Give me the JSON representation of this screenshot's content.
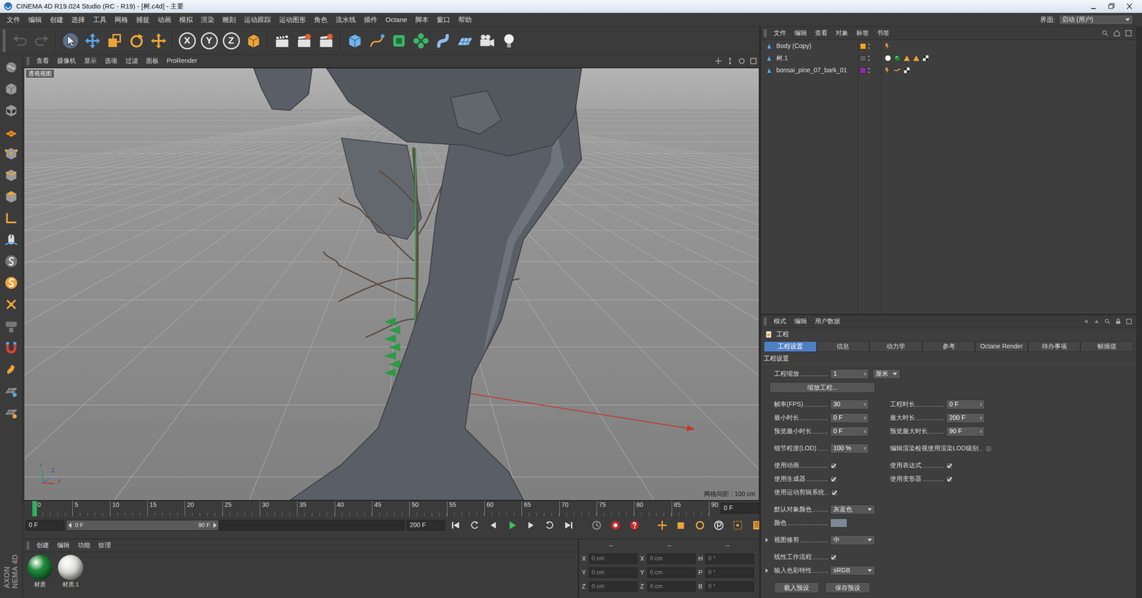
{
  "window": {
    "title": "CINEMA 4D R19.024 Studio (RC - R19) - [树.c4d] - 主要"
  },
  "menu": {
    "items": [
      "文件",
      "编辑",
      "创建",
      "选择",
      "工具",
      "网格",
      "捕捉",
      "动画",
      "模拟",
      "渲染",
      "雕刻",
      "运动跟踪",
      "运动图形",
      "角色",
      "流水线",
      "插件",
      "Octane",
      "脚本",
      "窗口",
      "帮助"
    ],
    "layout_label": "界面:",
    "layout_value": "启动 (用户)"
  },
  "toolbar": {
    "undo_disabled": true,
    "redo_disabled": true,
    "axes": [
      {
        "label": "X",
        "on": true
      },
      {
        "label": "Y",
        "on": true
      },
      {
        "label": "Z",
        "on": true
      }
    ]
  },
  "viewport": {
    "menu": [
      "查看",
      "摄像机",
      "显示",
      "选项",
      "过滤",
      "面板",
      "ProRender"
    ],
    "label": "透视视图",
    "grid_spacing": "网格间距 : 100 cm",
    "axes": [
      "Y",
      "Z",
      "X"
    ]
  },
  "timeline": {
    "ticks": [
      "0",
      "5",
      "10",
      "15",
      "20",
      "25",
      "30",
      "35",
      "40",
      "45",
      "50",
      "55",
      "60",
      "65",
      "70",
      "75",
      "80",
      "85",
      "90"
    ],
    "playhead_level": 0,
    "current": "0 F",
    "start": "0 F",
    "range_start": "0 F",
    "range_end": "90 F",
    "range_level": 0.45,
    "end": "200 F"
  },
  "materials": {
    "menu": [
      "创建",
      "编辑",
      "功能",
      "纹理"
    ],
    "items": [
      {
        "name": "材质",
        "color": "#1e8a3a"
      },
      {
        "name": "材质.1",
        "color": "#e4e4e0"
      }
    ]
  },
  "coordinates": {
    "headers": [
      "--",
      "--",
      "--"
    ],
    "rows": [
      [
        {
          "axis": "X",
          "value": "0 cm"
        },
        {
          "axis": "X",
          "value": "0 cm"
        },
        {
          "axis": "H",
          "value": "0 °"
        }
      ],
      [
        {
          "axis": "Y",
          "value": "0 cm"
        },
        {
          "axis": "Y",
          "value": "0 cm"
        },
        {
          "axis": "P",
          "value": "0 °"
        }
      ],
      [
        {
          "axis": "Z",
          "value": "0 cm"
        },
        {
          "axis": "Z",
          "value": "0 cm"
        },
        {
          "axis": "B",
          "value": "0 °"
        }
      ]
    ]
  },
  "objects": {
    "menu": [
      "文件",
      "编辑",
      "查看",
      "对象",
      "标签",
      "书签"
    ],
    "items": [
      {
        "name": "Body (Copy)",
        "layer": "#f0a321",
        "tags": [
          {
            "kind": "sketch"
          }
        ]
      },
      {
        "name": "树.1",
        "layer": "#5c5c5c",
        "tags": [
          {
            "kind": "material",
            "color": "#f2f2f2"
          },
          {
            "kind": "material",
            "color": "#1e8a3a"
          },
          {
            "kind": "triangle"
          },
          {
            "kind": "triangle"
          },
          {
            "kind": "checker"
          }
        ]
      },
      {
        "name": "bonsai_pine_07_bark_01",
        "layer": "#8d2bb0",
        "tags": [
          {
            "kind": "sketch"
          },
          {
            "kind": "wave"
          },
          {
            "kind": "checker"
          }
        ]
      }
    ]
  },
  "attributes": {
    "menu": [
      "模式",
      "编辑",
      "用户数据"
    ],
    "title": "工程",
    "tabs": [
      {
        "label": "工程设置",
        "selected": true
      },
      {
        "label": "信息",
        "selected": false
      },
      {
        "label": "动力学",
        "selected": false
      },
      {
        "label": "参考",
        "selected": false
      },
      {
        "label": "Octane Render",
        "selected": false
      },
      {
        "label": "待办事项",
        "selected": false
      },
      {
        "label": "帧插值",
        "selected": false
      }
    ],
    "section": "工程设置",
    "groups": [
      [
        [
          {
            "kind": "field",
            "label": "工程缩放",
            "value": "1",
            "unit": "厘米"
          }
        ],
        [
          {
            "kind": "button",
            "label": "缩放工程..."
          }
        ]
      ],
      [
        [
          {
            "kind": "field",
            "label": "帧率(FPS)",
            "value": "30"
          },
          {
            "kind": "field",
            "label": "工程时长",
            "value": "0 F"
          }
        ],
        [
          {
            "kind": "field",
            "label": "最小时长",
            "value": "0 F"
          },
          {
            "kind": "field",
            "label": "最大时长",
            "value": "200 F"
          }
        ],
        [
          {
            "kind": "field",
            "label": "预览最小时长",
            "value": "0 F"
          },
          {
            "kind": "field",
            "label": "预览最大时长",
            "value": "90 F"
          }
        ]
      ],
      [
        [
          {
            "kind": "field",
            "label": "细节程度(LOD)",
            "value": "100 %"
          },
          {
            "kind": "check",
            "label": "编辑渲染检视使用渲染LOD级别",
            "checked": false
          }
        ]
      ],
      [
        [
          {
            "kind": "check",
            "label": "使用动画",
            "checked": true
          },
          {
            "kind": "check",
            "label": "使用表达式",
            "checked": true
          }
        ],
        [
          {
            "kind": "check",
            "label": "使用生成器",
            "checked": true
          },
          {
            "kind": "check",
            "label": "使用变形器",
            "checked": true
          }
        ],
        [
          {
            "kind": "check",
            "label": "使用运动剪辑系统",
            "checked": true
          }
        ]
      ],
      [
        [
          {
            "kind": "dropdown",
            "label": "默认对象颜色",
            "value": "灰蓝色"
          }
        ],
        [
          {
            "kind": "color",
            "label": "颜色",
            "color": "#7d8796"
          }
        ]
      ],
      [
        [
          {
            "kind": "dropdown",
            "label": "视图修剪",
            "value": "中",
            "expanded": false
          }
        ]
      ],
      [
        [
          {
            "kind": "check",
            "label": "线性工作流程",
            "checked": true
          }
        ],
        [
          {
            "kind": "dropdown",
            "label": "输入色彩特性",
            "value": "sRGB",
            "expanded": false
          }
        ]
      ],
      [
        [
          {
            "kind": "button",
            "label": "载入预设"
          },
          {
            "kind": "button",
            "label": "保存预设"
          }
        ]
      ]
    ]
  },
  "brand": [
    "AXON",
    "NEMA 4D"
  ]
}
